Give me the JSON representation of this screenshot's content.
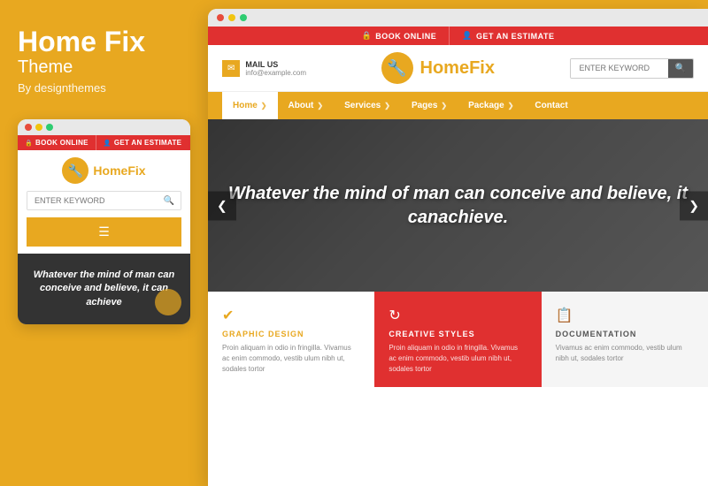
{
  "left": {
    "brand_title": "Home Fix",
    "brand_subtitle": "Theme",
    "brand_by": "By designthemes"
  },
  "mobile": {
    "topbar": [
      {
        "icon": "🔒",
        "label": "BOOK ONLINE"
      },
      {
        "icon": "👤",
        "label": "GET AN ESTIMATE"
      }
    ],
    "logo_text_part1": "Home",
    "logo_text_part2": "Fix",
    "search_placeholder": "ENTER KEYWORD",
    "hero_text": "Whatever the mind of man can conceive and believe, it can achieve"
  },
  "desktop": {
    "topbar": [
      {
        "icon": "🔒",
        "label": "BOOK ONLINE"
      },
      {
        "icon": "👤",
        "label": "GET AN ESTIMATE"
      }
    ],
    "mail_label": "MAIL US",
    "mail_email": "info@example.com",
    "logo_text_part1": "Home",
    "logo_text_part2": "Fix",
    "search_placeholder": "ENTER KEYWORD",
    "nav_items": [
      {
        "label": "Home",
        "active": true
      },
      {
        "label": "About",
        "active": false
      },
      {
        "label": "Services",
        "active": false
      },
      {
        "label": "Pages",
        "active": false
      },
      {
        "label": "Package",
        "active": false
      },
      {
        "label": "Contact",
        "active": false
      }
    ],
    "hero_text": "Whatever the mind of man can conceive and believe, it canachieve.",
    "cards": [
      {
        "type": "white",
        "icon": "✔",
        "title": "GRAPHIC DESIGN",
        "text": "Proin aliquam in odio in fringilla. Vivamus ac enim commodo, vestib ulum nibh ut, sodales tortor"
      },
      {
        "type": "orange",
        "icon": "↻",
        "title": "CREATIVE STYLES",
        "text": "Proin aliquam in odio in fringilla. Vivamus ac enim commodo, vestib ulum nibh ut, sodales tortor"
      },
      {
        "type": "light",
        "icon": "📋",
        "title": "DOCUMENTATION",
        "text": "Vivamus ac enim commodo, vestib ulum nibh ut, sodales tortor"
      }
    ]
  },
  "dots": {
    "red": "#e74c3c",
    "yellow": "#f1c40f",
    "green": "#2ecc71"
  }
}
